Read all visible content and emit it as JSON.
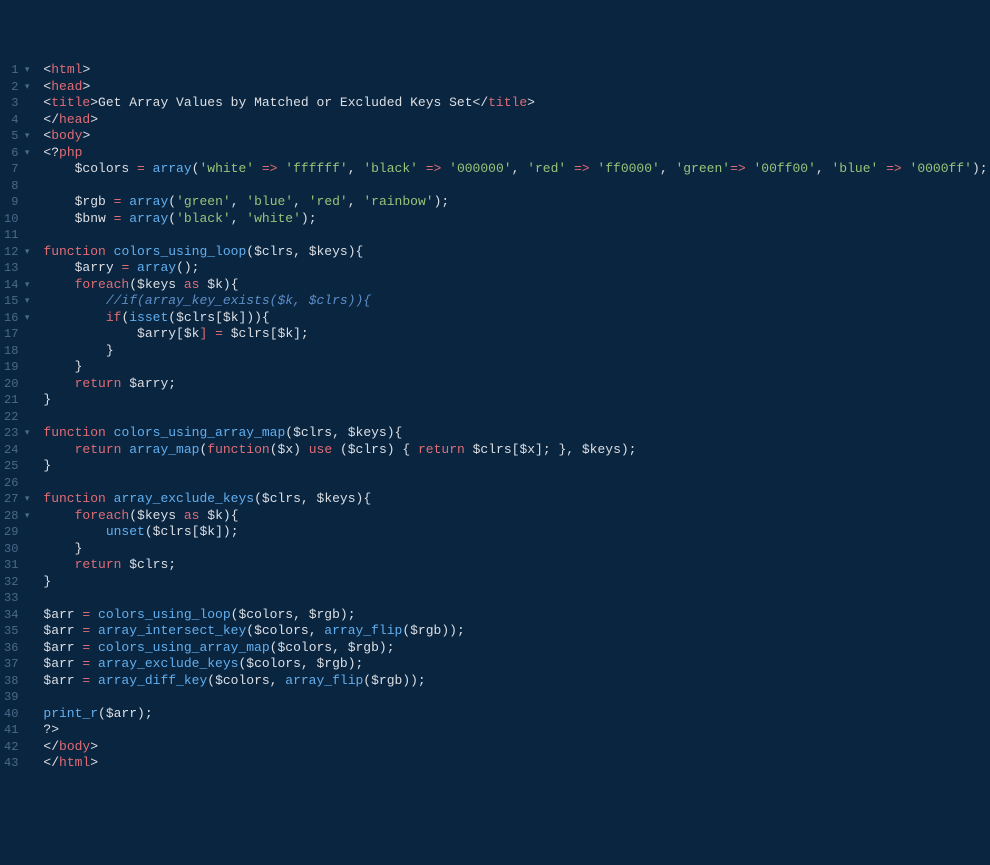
{
  "gutter": {
    "foldable": [
      1,
      2,
      5,
      6,
      12,
      14,
      15,
      16,
      23,
      27,
      28
    ],
    "count": 43
  },
  "lines": {
    "l1": [
      [
        "<",
        "p"
      ],
      [
        "html",
        "r"
      ],
      [
        ">",
        "p"
      ]
    ],
    "l2": [
      [
        "<",
        "p"
      ],
      [
        "head",
        "r"
      ],
      [
        ">",
        "p"
      ]
    ],
    "l3": [
      [
        "<",
        "p"
      ],
      [
        "title",
        "r"
      ],
      [
        ">",
        "p"
      ],
      [
        "Get Array Values by Matched or Excluded Keys Set",
        "w"
      ],
      [
        "</",
        "p"
      ],
      [
        "title",
        "r"
      ],
      [
        ">",
        "p"
      ]
    ],
    "l4": [
      [
        "</",
        "p"
      ],
      [
        "head",
        "r"
      ],
      [
        ">",
        "p"
      ]
    ],
    "l5": [
      [
        "<",
        "p"
      ],
      [
        "body",
        "r"
      ],
      [
        ">",
        "p"
      ]
    ],
    "l6": [
      [
        "<?",
        "p"
      ],
      [
        "php",
        "r"
      ]
    ],
    "l7": [
      [
        "    ",
        "n"
      ],
      [
        "$colors",
        "w"
      ],
      [
        " = ",
        "o"
      ],
      [
        "array",
        "b"
      ],
      [
        "(",
        "p"
      ],
      [
        "'white'",
        "g"
      ],
      [
        " => ",
        "o"
      ],
      [
        "'ffffff'",
        "g"
      ],
      [
        ", ",
        "p"
      ],
      [
        "'black'",
        "g"
      ],
      [
        " => ",
        "o"
      ],
      [
        "'000000'",
        "g"
      ],
      [
        ", ",
        "p"
      ],
      [
        "'red'",
        "g"
      ],
      [
        " => ",
        "o"
      ],
      [
        "'ff0000'",
        "g"
      ],
      [
        ", ",
        "p"
      ],
      [
        "'green'",
        "g"
      ],
      [
        "=> ",
        "o"
      ],
      [
        "'00ff00'",
        "g"
      ],
      [
        ", ",
        "p"
      ],
      [
        "'blue'",
        "g"
      ],
      [
        " => ",
        "o"
      ],
      [
        "'0000ff'",
        "g"
      ],
      [
        ");",
        "p"
      ]
    ],
    "l8": [
      [
        "",
        "n"
      ]
    ],
    "l9": [
      [
        "    ",
        "n"
      ],
      [
        "$rgb",
        "w"
      ],
      [
        " = ",
        "o"
      ],
      [
        "array",
        "b"
      ],
      [
        "(",
        "p"
      ],
      [
        "'green'",
        "g"
      ],
      [
        ", ",
        "p"
      ],
      [
        "'blue'",
        "g"
      ],
      [
        ", ",
        "p"
      ],
      [
        "'red'",
        "g"
      ],
      [
        ", ",
        "p"
      ],
      [
        "'rainbow'",
        "g"
      ],
      [
        ");",
        "p"
      ]
    ],
    "l10": [
      [
        "    ",
        "n"
      ],
      [
        "$bnw",
        "w"
      ],
      [
        " = ",
        "o"
      ],
      [
        "array",
        "b"
      ],
      [
        "(",
        "p"
      ],
      [
        "'black'",
        "g"
      ],
      [
        ", ",
        "p"
      ],
      [
        "'white'",
        "g"
      ],
      [
        ");",
        "p"
      ]
    ],
    "l11": [
      [
        "",
        "n"
      ]
    ],
    "l12": [
      [
        "function",
        "r"
      ],
      [
        " ",
        "n"
      ],
      [
        "colors_using_loop",
        "b"
      ],
      [
        "(",
        "p"
      ],
      [
        "$clrs",
        "w"
      ],
      [
        ", ",
        "p"
      ],
      [
        "$keys",
        "w"
      ],
      [
        "){",
        "p"
      ]
    ],
    "l13": [
      [
        "    ",
        "n"
      ],
      [
        "$arry",
        "w"
      ],
      [
        " = ",
        "o"
      ],
      [
        "array",
        "b"
      ],
      [
        "();",
        "p"
      ]
    ],
    "l14": [
      [
        "    ",
        "n"
      ],
      [
        "foreach",
        "r"
      ],
      [
        "(",
        "p"
      ],
      [
        "$keys",
        "w"
      ],
      [
        " ",
        "n"
      ],
      [
        "as",
        "r"
      ],
      [
        " ",
        "n"
      ],
      [
        "$k",
        "w"
      ],
      [
        "){",
        "p"
      ]
    ],
    "l15": [
      [
        "        ",
        "n"
      ],
      [
        "//if(array_key_exists($k, $clrs)){",
        "c"
      ]
    ],
    "l16": [
      [
        "        ",
        "n"
      ],
      [
        "if",
        "r"
      ],
      [
        "(",
        "p"
      ],
      [
        "isset",
        "b"
      ],
      [
        "(",
        "p"
      ],
      [
        "$clrs",
        "w"
      ],
      [
        "[",
        "p"
      ],
      [
        "$k",
        "w"
      ],
      [
        "])){",
        "p"
      ]
    ],
    "l17": [
      [
        "            ",
        "n"
      ],
      [
        "$arry",
        "w"
      ],
      [
        "[",
        "p"
      ],
      [
        "$k",
        "w"
      ],
      [
        "] = ",
        "o"
      ],
      [
        "$clrs",
        "w"
      ],
      [
        "[",
        "p"
      ],
      [
        "$k",
        "w"
      ],
      [
        "];",
        "p"
      ]
    ],
    "l18": [
      [
        "        ",
        "n"
      ],
      [
        "}",
        "p"
      ]
    ],
    "l19": [
      [
        "    ",
        "n"
      ],
      [
        "}",
        "p"
      ]
    ],
    "l20": [
      [
        "    ",
        "n"
      ],
      [
        "return",
        "r"
      ],
      [
        " ",
        "n"
      ],
      [
        "$arry",
        "w"
      ],
      [
        ";",
        "p"
      ]
    ],
    "l21": [
      [
        "}",
        "p"
      ]
    ],
    "l22": [
      [
        "",
        "n"
      ]
    ],
    "l23": [
      [
        "function",
        "r"
      ],
      [
        " ",
        "n"
      ],
      [
        "colors_using_array_map",
        "b"
      ],
      [
        "(",
        "p"
      ],
      [
        "$clrs",
        "w"
      ],
      [
        ", ",
        "p"
      ],
      [
        "$keys",
        "w"
      ],
      [
        "){",
        "p"
      ]
    ],
    "l24": [
      [
        "    ",
        "n"
      ],
      [
        "return",
        "r"
      ],
      [
        " ",
        "n"
      ],
      [
        "array_map",
        "b"
      ],
      [
        "(",
        "p"
      ],
      [
        "function",
        "r"
      ],
      [
        "(",
        "p"
      ],
      [
        "$x",
        "w"
      ],
      [
        ") ",
        "p"
      ],
      [
        "use",
        "r"
      ],
      [
        " (",
        "p"
      ],
      [
        "$clrs",
        "w"
      ],
      [
        ") { ",
        "p"
      ],
      [
        "return",
        "r"
      ],
      [
        " ",
        "n"
      ],
      [
        "$clrs",
        "w"
      ],
      [
        "[",
        "p"
      ],
      [
        "$x",
        "w"
      ],
      [
        "]; }, ",
        "p"
      ],
      [
        "$keys",
        "w"
      ],
      [
        ");",
        "p"
      ]
    ],
    "l25": [
      [
        "}",
        "p"
      ]
    ],
    "l26": [
      [
        "",
        "n"
      ]
    ],
    "l27": [
      [
        "function",
        "r"
      ],
      [
        " ",
        "n"
      ],
      [
        "array_exclude_keys",
        "b"
      ],
      [
        "(",
        "p"
      ],
      [
        "$clrs",
        "w"
      ],
      [
        ", ",
        "p"
      ],
      [
        "$keys",
        "w"
      ],
      [
        "){",
        "p"
      ]
    ],
    "l28": [
      [
        "    ",
        "n"
      ],
      [
        "foreach",
        "r"
      ],
      [
        "(",
        "p"
      ],
      [
        "$keys",
        "w"
      ],
      [
        " ",
        "n"
      ],
      [
        "as",
        "r"
      ],
      [
        " ",
        "n"
      ],
      [
        "$k",
        "w"
      ],
      [
        "){",
        "p"
      ]
    ],
    "l29": [
      [
        "        ",
        "n"
      ],
      [
        "unset",
        "b"
      ],
      [
        "(",
        "p"
      ],
      [
        "$clrs",
        "w"
      ],
      [
        "[",
        "p"
      ],
      [
        "$k",
        "w"
      ],
      [
        "]);",
        "p"
      ]
    ],
    "l30": [
      [
        "    ",
        "n"
      ],
      [
        "}",
        "p"
      ]
    ],
    "l31": [
      [
        "    ",
        "n"
      ],
      [
        "return",
        "r"
      ],
      [
        " ",
        "n"
      ],
      [
        "$clrs",
        "w"
      ],
      [
        ";",
        "p"
      ]
    ],
    "l32": [
      [
        "}",
        "p"
      ]
    ],
    "l33": [
      [
        "",
        "n"
      ]
    ],
    "l34": [
      [
        "$arr",
        "w"
      ],
      [
        " = ",
        "o"
      ],
      [
        "colors_using_loop",
        "b"
      ],
      [
        "(",
        "p"
      ],
      [
        "$colors",
        "w"
      ],
      [
        ", ",
        "p"
      ],
      [
        "$rgb",
        "w"
      ],
      [
        ");",
        "p"
      ]
    ],
    "l35": [
      [
        "$arr",
        "w"
      ],
      [
        " = ",
        "o"
      ],
      [
        "array_intersect_key",
        "b"
      ],
      [
        "(",
        "p"
      ],
      [
        "$colors",
        "w"
      ],
      [
        ", ",
        "p"
      ],
      [
        "array_flip",
        "b"
      ],
      [
        "(",
        "p"
      ],
      [
        "$rgb",
        "w"
      ],
      [
        "));",
        "p"
      ]
    ],
    "l36": [
      [
        "$arr",
        "w"
      ],
      [
        " = ",
        "o"
      ],
      [
        "colors_using_array_map",
        "b"
      ],
      [
        "(",
        "p"
      ],
      [
        "$colors",
        "w"
      ],
      [
        ", ",
        "p"
      ],
      [
        "$rgb",
        "w"
      ],
      [
        ");",
        "p"
      ]
    ],
    "l37": [
      [
        "$arr",
        "w"
      ],
      [
        " = ",
        "o"
      ],
      [
        "array_exclude_keys",
        "b"
      ],
      [
        "(",
        "p"
      ],
      [
        "$colors",
        "w"
      ],
      [
        ", ",
        "p"
      ],
      [
        "$rgb",
        "w"
      ],
      [
        ");",
        "p"
      ]
    ],
    "l38": [
      [
        "$arr",
        "w"
      ],
      [
        " = ",
        "o"
      ],
      [
        "array_diff_key",
        "b"
      ],
      [
        "(",
        "p"
      ],
      [
        "$colors",
        "w"
      ],
      [
        ", ",
        "p"
      ],
      [
        "array_flip",
        "b"
      ],
      [
        "(",
        "p"
      ],
      [
        "$rgb",
        "w"
      ],
      [
        "));",
        "p"
      ]
    ],
    "l39": [
      [
        "",
        "n"
      ]
    ],
    "l40": [
      [
        "print_r",
        "b"
      ],
      [
        "(",
        "p"
      ],
      [
        "$arr",
        "w"
      ],
      [
        ");",
        "p"
      ]
    ],
    "l41": [
      [
        "?>",
        "p"
      ]
    ],
    "l42": [
      [
        "</",
        "p"
      ],
      [
        "body",
        "r"
      ],
      [
        ">",
        "p"
      ]
    ],
    "l43": [
      [
        "</",
        "p"
      ],
      [
        "html",
        "r"
      ],
      [
        ">",
        "p"
      ]
    ]
  },
  "colormap": {
    "r": "#e06c75",
    "b": "#61afef",
    "g": "#98c379",
    "w": "#dcdfe4",
    "p": "#dcdfe4",
    "o": "#e06c75",
    "c": "#5c8ec7",
    "n": "#dcdfe4"
  }
}
